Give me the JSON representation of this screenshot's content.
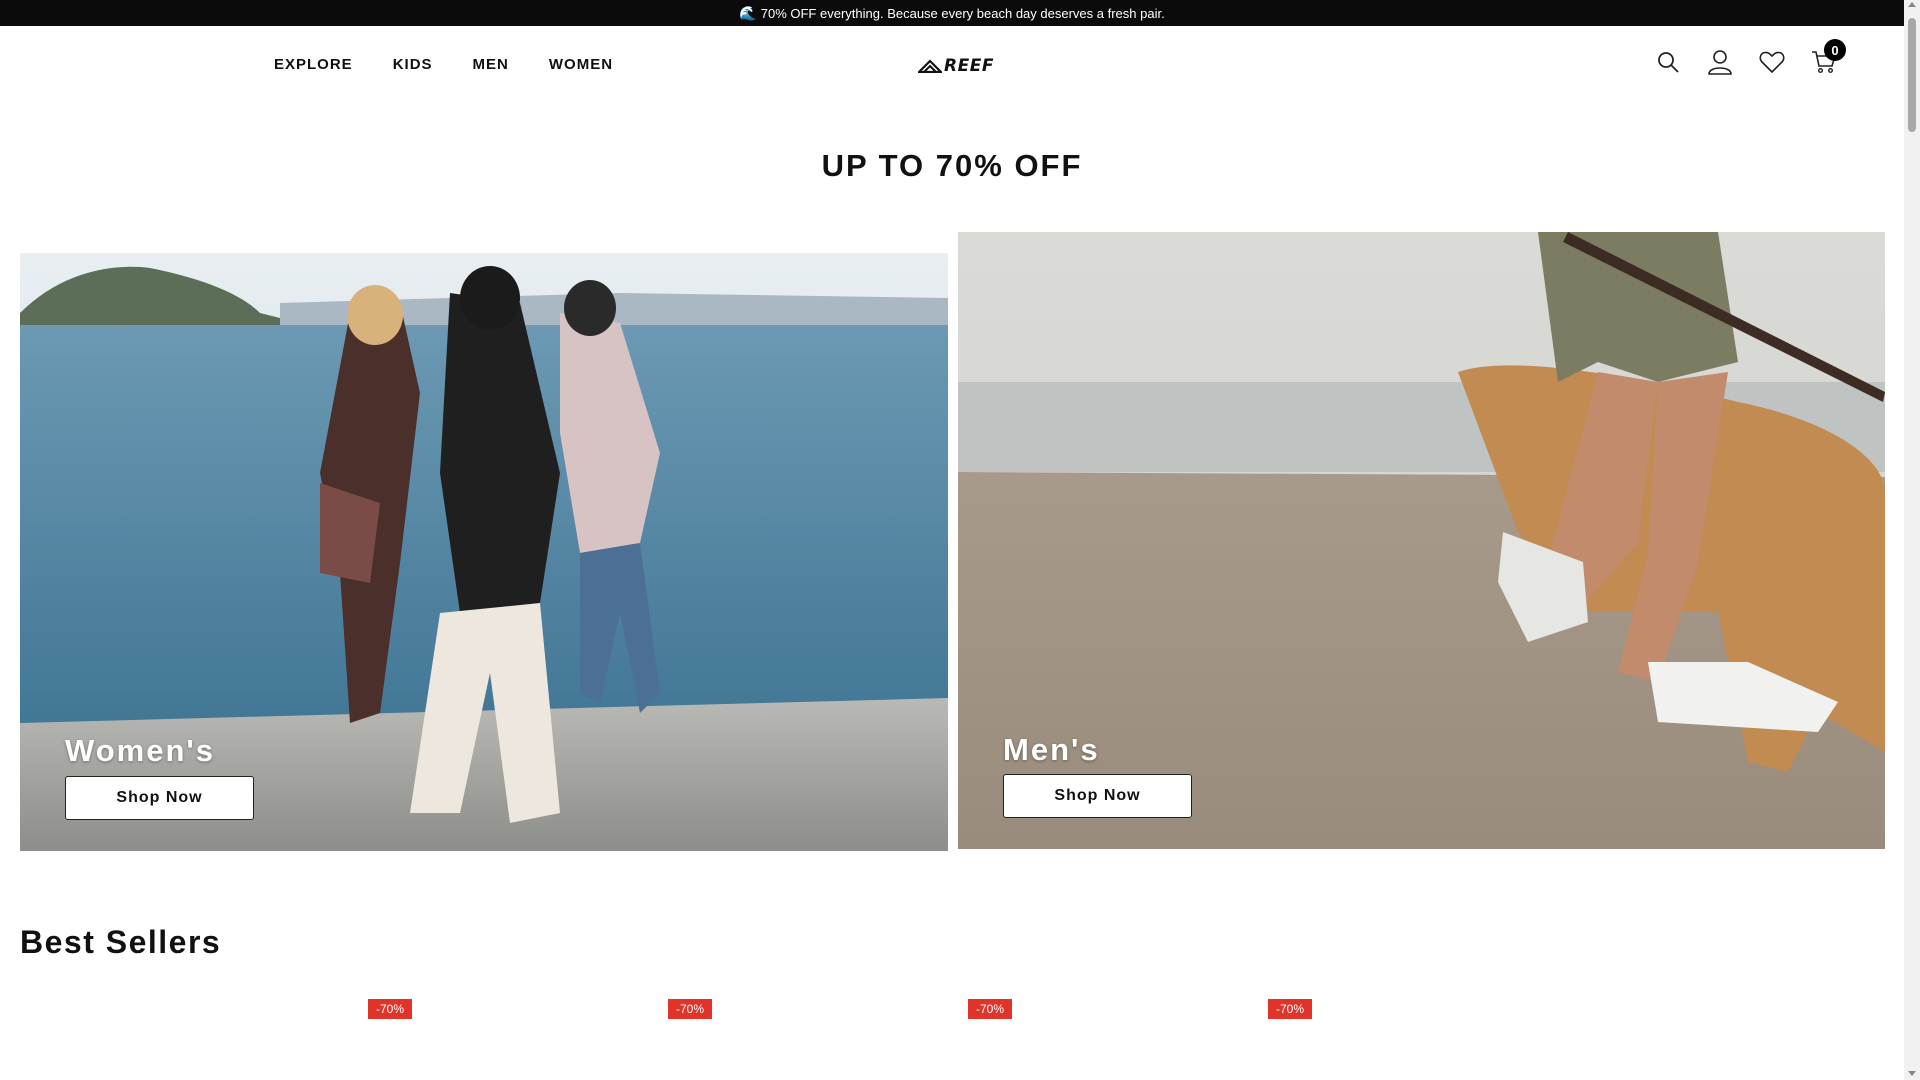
{
  "announcement": {
    "icon": "wave-icon",
    "text": "70% OFF everything. Because every beach day deserves a fresh pair."
  },
  "nav": {
    "items": [
      "EXPLORE",
      "KIDS",
      "MEN",
      "WOMEN"
    ]
  },
  "logo": {
    "text": "REEF"
  },
  "header_icons": {
    "search": "search-icon",
    "account": "user-icon",
    "wishlist": "heart-icon",
    "cart": "cart-icon",
    "cart_count": "0"
  },
  "hero": {
    "headline": "UP TO 70% OFF"
  },
  "panels": [
    {
      "label": "Women's",
      "button": "Shop Now"
    },
    {
      "label": "Men's",
      "button": "Shop Now"
    }
  ],
  "best_sellers": {
    "title": "Best Sellers",
    "badges": [
      "-70%",
      "-70%",
      "-70%",
      "-70%"
    ]
  },
  "colors": {
    "announcement_bg": "#0b0b0b",
    "badge_red": "#e0342b"
  }
}
